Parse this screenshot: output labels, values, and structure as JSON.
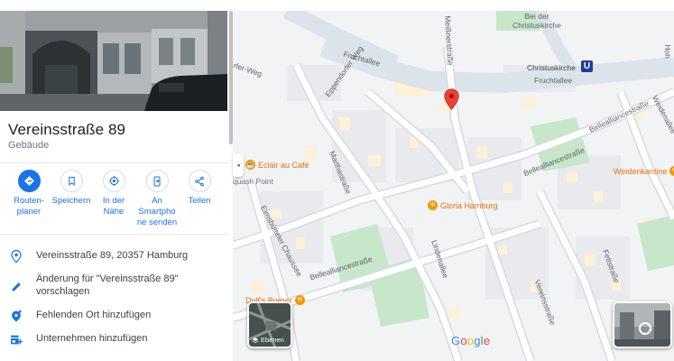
{
  "place": {
    "title": "Vereinsstraße 89",
    "category": "Gebäude"
  },
  "actions": [
    {
      "label": "Routen-\nplaner",
      "icon": "directions-icon"
    },
    {
      "label": "Speichern",
      "icon": "bookmark-icon"
    },
    {
      "label": "In der\nNähe",
      "icon": "nearby-icon"
    },
    {
      "label": "An\nSmartpho\nne senden",
      "icon": "send-to-phone-icon"
    },
    {
      "label": "Teilen",
      "icon": "share-icon"
    }
  ],
  "rows": [
    {
      "text": "Vereinsstraße 89, 20357 Hamburg",
      "icon": "location-pin-icon"
    },
    {
      "text": "Änderung für \"Vereinsstraße 89\" vorschlagen",
      "icon": "edit-pencil-icon"
    },
    {
      "text": "Fehlenden Ort hinzufügen",
      "icon": "add-place-icon"
    },
    {
      "text": "Unternehmen hinzufügen",
      "icon": "add-business-icon"
    }
  ],
  "map": {
    "street_labels": {
      "fruchtallee_top": "Fruchtallee",
      "fruchtallee_right": "Fruchtallee",
      "eppendorfer": "Eppendorfer Weg",
      "meissner": "Meißnerstraße",
      "martha": "Marthastraße",
      "bellealliance_1": "Bellealliancestraße",
      "bellealliance_2": "Bellealliancestraße",
      "bellealliance_3": "Bellealliancestraße",
      "bellealliance_4": "Bellealliancestraße",
      "eimsbuetteler": "Eimsbütteler Chaussee",
      "linden": "Lindenallee",
      "vereins": "Vereinsstraße",
      "fett": "Fettstraße",
      "weiden": "Weidenallee",
      "kirche": "Bei der\nChristuskirche",
      "christuskirche": "Christuskirche",
      "tohr": "Hoh",
      "weg": "rfer-Weg",
      "squash": "quash Point"
    },
    "pois": {
      "eclair": "Eclair au Café",
      "gloria": "Gloria Hamburg",
      "weidenkantine": "Weidenkantine",
      "dulfs": "Dulf's Burger"
    },
    "subway_badge": "U",
    "layers_label": "Ebenen",
    "brand": "Google",
    "collapse_glyph": "◂"
  },
  "colors": {
    "accent": "#1a73e8",
    "pin": "#ea4335",
    "poi": "#e8710a",
    "park": "#c8e6c9",
    "road": "#ffffff",
    "main_road": "#dde3ea"
  }
}
